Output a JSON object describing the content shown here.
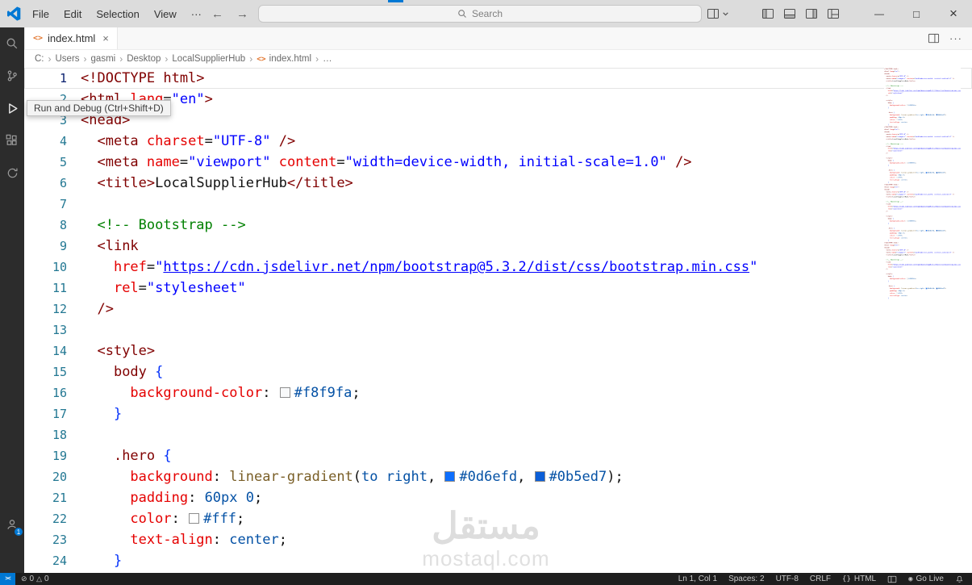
{
  "window": {
    "menus": [
      "File",
      "Edit",
      "Selection",
      "View",
      "···"
    ],
    "nav": {
      "back": "←",
      "forward": "→"
    },
    "search_placeholder": "Search",
    "controls": {
      "minimize": "—",
      "maximize": "□",
      "close": "×"
    }
  },
  "activity_bar": {
    "account_badge": "1"
  },
  "tab_bar": {
    "active_tab": "index.html",
    "file_icon": "<>",
    "close": "×",
    "more": "···"
  },
  "breadcrumb": {
    "items": [
      {
        "label": "C:"
      },
      {
        "label": "Users"
      },
      {
        "label": "gasmi"
      },
      {
        "label": "Desktop"
      },
      {
        "label": "LocalSupplierHub"
      },
      {
        "label": "index.html",
        "icon": "html-file-icon"
      },
      {
        "label": "…"
      }
    ]
  },
  "tooltip": {
    "text": "Run and Debug (Ctrl+Shift+D)"
  },
  "editor": {
    "active_line": 1,
    "lines": [
      {
        "n": 1,
        "t": [
          [
            "tag",
            "<!DOCTYPE html>"
          ]
        ]
      },
      {
        "n": 2,
        "t": [
          [
            "tag",
            "<html"
          ],
          [
            "txt",
            " "
          ],
          [
            "attr",
            "lang"
          ],
          [
            "txt",
            "="
          ],
          [
            "str",
            "\"en\""
          ],
          [
            "tag",
            ">"
          ]
        ]
      },
      {
        "n": 3,
        "t": [
          [
            "tag",
            "<head>"
          ]
        ]
      },
      {
        "n": 4,
        "t": [
          [
            "txt",
            "  "
          ],
          [
            "tag",
            "<meta"
          ],
          [
            "txt",
            " "
          ],
          [
            "attr",
            "charset"
          ],
          [
            "txt",
            "="
          ],
          [
            "str",
            "\"UTF-8\""
          ],
          [
            "txt",
            " "
          ],
          [
            "tag",
            "/>"
          ]
        ]
      },
      {
        "n": 5,
        "t": [
          [
            "txt",
            "  "
          ],
          [
            "tag",
            "<meta"
          ],
          [
            "txt",
            " "
          ],
          [
            "attr",
            "name"
          ],
          [
            "txt",
            "="
          ],
          [
            "str",
            "\"viewport\""
          ],
          [
            "txt",
            " "
          ],
          [
            "attr",
            "content"
          ],
          [
            "txt",
            "="
          ],
          [
            "str",
            "\"width=device-width, initial-scale=1.0\""
          ],
          [
            "txt",
            " "
          ],
          [
            "tag",
            "/>"
          ]
        ]
      },
      {
        "n": 6,
        "t": [
          [
            "txt",
            "  "
          ],
          [
            "tag",
            "<title>"
          ],
          [
            "txt",
            "LocalSupplierHub"
          ],
          [
            "tag",
            "</title>"
          ]
        ]
      },
      {
        "n": 7,
        "t": []
      },
      {
        "n": 8,
        "t": [
          [
            "txt",
            "  "
          ],
          [
            "com",
            "<!-- Bootstrap -->"
          ]
        ]
      },
      {
        "n": 9,
        "t": [
          [
            "txt",
            "  "
          ],
          [
            "tag",
            "<link"
          ]
        ]
      },
      {
        "n": 10,
        "t": [
          [
            "txt",
            "    "
          ],
          [
            "attr",
            "href"
          ],
          [
            "txt",
            "="
          ],
          [
            "str",
            "\""
          ],
          [
            "url",
            "https://cdn.jsdelivr.net/npm/bootstrap@5.3.2/dist/css/bootstrap.min.css"
          ],
          [
            "str",
            "\""
          ]
        ]
      },
      {
        "n": 11,
        "t": [
          [
            "txt",
            "    "
          ],
          [
            "attr",
            "rel"
          ],
          [
            "txt",
            "="
          ],
          [
            "str",
            "\"stylesheet\""
          ]
        ]
      },
      {
        "n": 12,
        "t": [
          [
            "txt",
            "  "
          ],
          [
            "tag",
            "/>"
          ]
        ]
      },
      {
        "n": 13,
        "t": []
      },
      {
        "n": 14,
        "t": [
          [
            "txt",
            "  "
          ],
          [
            "tag",
            "<style>"
          ]
        ]
      },
      {
        "n": 15,
        "t": [
          [
            "txt",
            "    "
          ],
          [
            "sel",
            "body"
          ],
          [
            "txt",
            " "
          ],
          [
            "brace",
            "{"
          ]
        ]
      },
      {
        "n": 16,
        "t": [
          [
            "txt",
            "      "
          ],
          [
            "prop",
            "background-color"
          ],
          [
            "txt",
            ": "
          ],
          [
            "swatch",
            "#f8f9fa"
          ],
          [
            "val",
            "#f8f9fa"
          ],
          [
            "txt",
            ";"
          ]
        ]
      },
      {
        "n": 17,
        "t": [
          [
            "txt",
            "    "
          ],
          [
            "brace",
            "}"
          ]
        ]
      },
      {
        "n": 18,
        "t": []
      },
      {
        "n": 19,
        "t": [
          [
            "txt",
            "    "
          ],
          [
            "sel",
            ".hero"
          ],
          [
            "txt",
            " "
          ],
          [
            "brace",
            "{"
          ]
        ]
      },
      {
        "n": 20,
        "t": [
          [
            "txt",
            "      "
          ],
          [
            "prop",
            "background"
          ],
          [
            "txt",
            ": "
          ],
          [
            "fn",
            "linear-gradient"
          ],
          [
            "txt",
            "("
          ],
          [
            "val",
            "to right"
          ],
          [
            "txt",
            ", "
          ],
          [
            "swatch",
            "#0d6efd"
          ],
          [
            "val",
            "#0d6efd"
          ],
          [
            "txt",
            ", "
          ],
          [
            "swatch",
            "#0b5ed7"
          ],
          [
            "val",
            "#0b5ed7"
          ],
          [
            "txt",
            ");"
          ]
        ]
      },
      {
        "n": 21,
        "t": [
          [
            "txt",
            "      "
          ],
          [
            "prop",
            "padding"
          ],
          [
            "txt",
            ": "
          ],
          [
            "val",
            "60px 0"
          ],
          [
            "txt",
            ";"
          ]
        ]
      },
      {
        "n": 22,
        "t": [
          [
            "txt",
            "      "
          ],
          [
            "prop",
            "color"
          ],
          [
            "txt",
            ": "
          ],
          [
            "swatch",
            "#fff"
          ],
          [
            "val",
            "#fff"
          ],
          [
            "txt",
            ";"
          ]
        ]
      },
      {
        "n": 23,
        "t": [
          [
            "txt",
            "      "
          ],
          [
            "prop",
            "text-align"
          ],
          [
            "txt",
            ": "
          ],
          [
            "val",
            "center"
          ],
          [
            "txt",
            ";"
          ]
        ]
      },
      {
        "n": 24,
        "t": [
          [
            "txt",
            "    "
          ],
          [
            "brace",
            "}"
          ]
        ]
      }
    ]
  },
  "minimap": {
    "repeat": 4
  },
  "status_bar": {
    "remote_glyph": "><",
    "errors": "0",
    "warnings": "0",
    "items_right": [
      {
        "id": "cursor-position",
        "label": "Ln 1, Col 1"
      },
      {
        "id": "indentation",
        "label": "Spaces: 2"
      },
      {
        "id": "encoding",
        "label": "UTF-8"
      },
      {
        "id": "eol",
        "label": "CRLF"
      },
      {
        "id": "language-mode",
        "label": "HTML",
        "icon": "braces-icon"
      },
      {
        "id": "editor-layout",
        "label": "",
        "icon": "layout-icon"
      },
      {
        "id": "go-live",
        "label": "Go Live",
        "icon": "broadcast-icon"
      },
      {
        "id": "notifications",
        "label": "",
        "icon": "bell-icon"
      }
    ]
  },
  "icons": {
    "error": "⊘",
    "warning": "△"
  },
  "watermark": {
    "heading": "مستقل",
    "domain": "mostaql.com"
  },
  "colors": {
    "accent": "#0078d4",
    "titlebar": "#dcdcdc",
    "activitybar": "#2c2c2c",
    "statusbar": "#1e1e1e"
  }
}
